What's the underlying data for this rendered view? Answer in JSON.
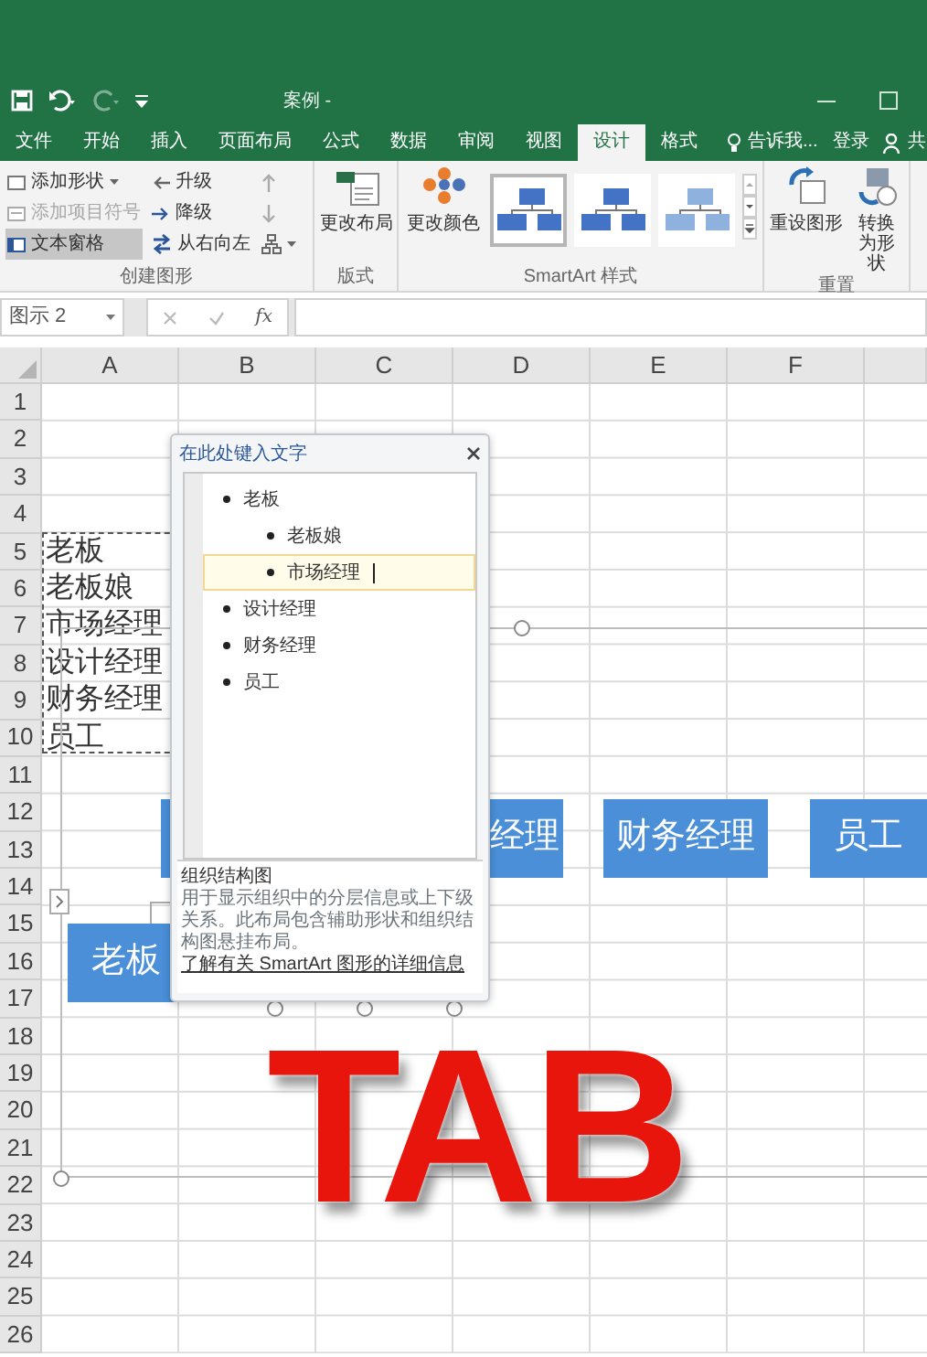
{
  "title_bar": {
    "title": "案例 -"
  },
  "tabs": [
    {
      "label": "文件",
      "selected": false
    },
    {
      "label": "开始",
      "selected": false
    },
    {
      "label": "插入",
      "selected": false
    },
    {
      "label": "页面布局",
      "selected": false
    },
    {
      "label": "公式",
      "selected": false
    },
    {
      "label": "数据",
      "selected": false
    },
    {
      "label": "审阅",
      "selected": false
    },
    {
      "label": "视图",
      "selected": false
    },
    {
      "label": "设计",
      "selected": true
    },
    {
      "label": "格式",
      "selected": false
    }
  ],
  "tell_me": "告诉我...",
  "sign_in": "登录",
  "share": "共",
  "ribbon": {
    "create_graphic": {
      "label": "创建图形",
      "add_shape": {
        "label": "添加形状",
        "disabled": false
      },
      "add_bullet": {
        "label": "添加项目符号",
        "disabled": true
      },
      "text_pane": {
        "label": "文本窗格",
        "selected": true
      },
      "promote": "升级",
      "demote": "降级",
      "right_to_left": "从右向左"
    },
    "layouts": {
      "label": "版式",
      "change_layout": "更改布局"
    },
    "styles": {
      "label": "SmartArt 样式",
      "change_colors": "更改颜色",
      "thumbnails": [
        {
          "selected": true
        },
        {
          "selected": false
        },
        {
          "selected": false
        }
      ]
    },
    "reset": {
      "label": "重置",
      "reset_graphic": "重设图形",
      "convert": "转换为形状"
    }
  },
  "formula_bar": {
    "name_box": "图示 2",
    "function_label": "fx"
  },
  "sheet": {
    "columns": [
      "A",
      "B",
      "C",
      "D",
      "E",
      "F"
    ],
    "rows": [
      {
        "header": "1"
      },
      {
        "header": "2"
      },
      {
        "header": "3"
      },
      {
        "header": "4"
      },
      {
        "header": "5",
        "a": "老板"
      },
      {
        "header": "6",
        "a": "老板娘"
      },
      {
        "header": "7",
        "a": "市场经理"
      },
      {
        "header": "8",
        "a": "设计经理"
      },
      {
        "header": "9",
        "a": "财务经理"
      },
      {
        "header": "10",
        "a": "员工"
      },
      {
        "header": "11"
      },
      {
        "header": "12"
      },
      {
        "header": "13"
      },
      {
        "header": "14"
      },
      {
        "header": "15"
      },
      {
        "header": "16"
      },
      {
        "header": "17"
      },
      {
        "header": "18"
      },
      {
        "header": "19"
      },
      {
        "header": "20"
      },
      {
        "header": "21"
      },
      {
        "header": "22"
      },
      {
        "header": "23"
      },
      {
        "header": "24"
      },
      {
        "header": "25"
      },
      {
        "header": "26"
      }
    ]
  },
  "smartart": {
    "shapes": [
      {
        "text": "老板"
      },
      {
        "text": "经理"
      },
      {
        "text": "财务经理"
      },
      {
        "text": "员工"
      }
    ]
  },
  "text_pane": {
    "title": "在此处键入文字",
    "items": [
      {
        "text": "老板",
        "selected": false,
        "children": [
          {
            "text": "老板娘",
            "selected": false
          },
          {
            "text": "市场经理",
            "selected": true
          }
        ]
      },
      {
        "text": "设计经理",
        "selected": false
      },
      {
        "text": "财务经理",
        "selected": false
      },
      {
        "text": "员工",
        "selected": false
      }
    ],
    "description_title": "组织结构图",
    "description": "用于显示组织中的分层信息或上下级关系。此布局包含辅助形状和组织结构图悬挂布局。",
    "link": "了解有关 SmartArt 图形的详细信息"
  },
  "caption": "TAB"
}
